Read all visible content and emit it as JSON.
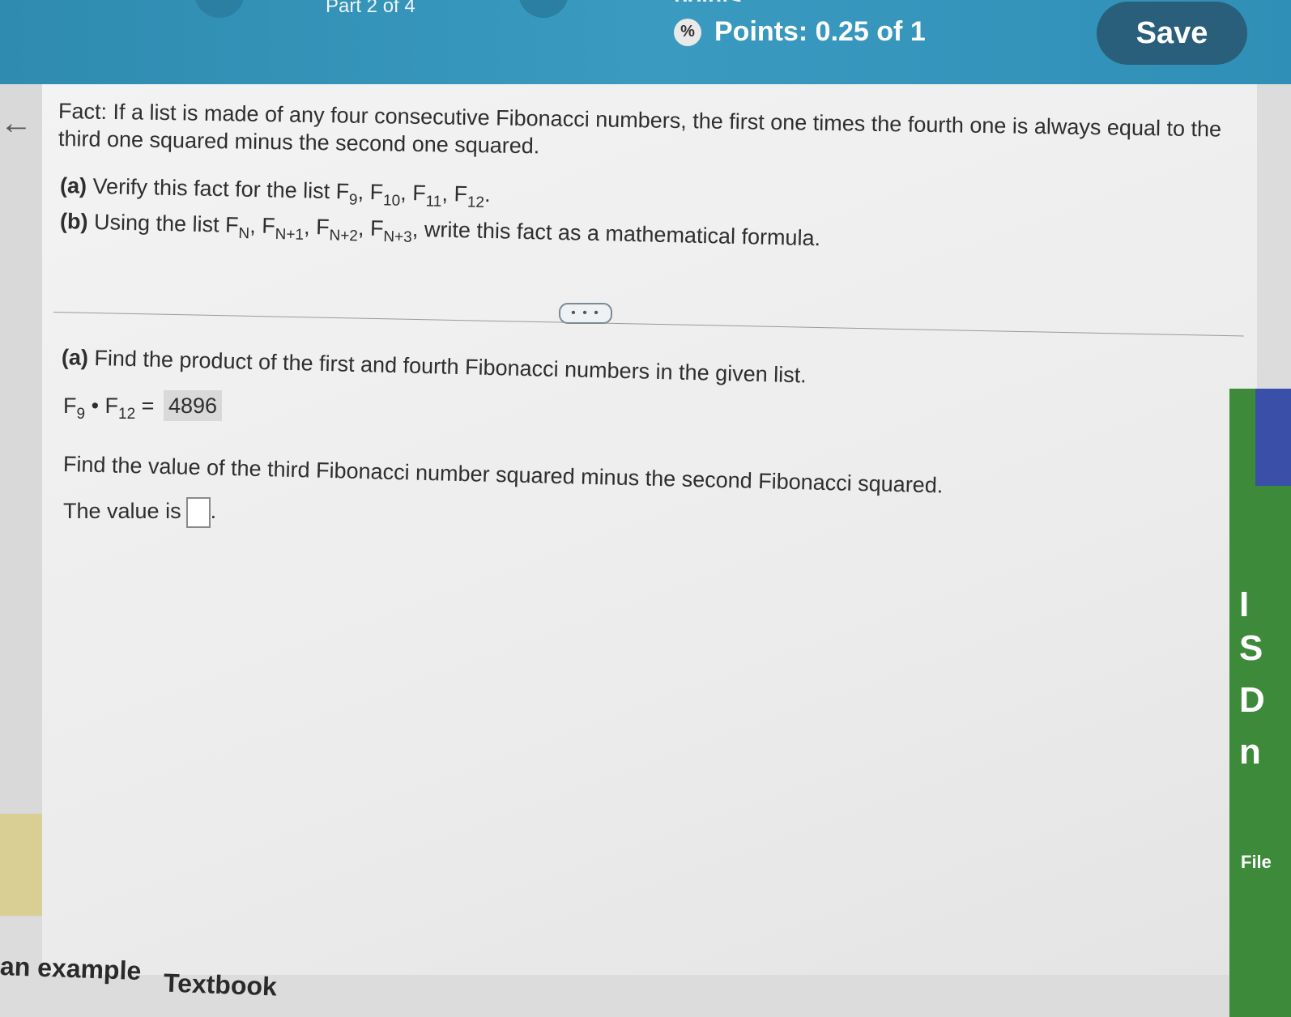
{
  "header": {
    "part_label": "Part 2 of 4",
    "points_top": "points",
    "points_text": "Points: 0.25 of 1",
    "points_icon": "%",
    "save_label": "Save"
  },
  "fact": {
    "line1": "Fact: If a list is made of any four consecutive Fibonacci numbers, the first one times the fourth one is always equal to the",
    "line2": "third one squared minus the second one squared."
  },
  "parts": {
    "a_label": "(a)",
    "a_text": " Verify this fact for the list F",
    "a_subs": [
      "9",
      "10",
      "11",
      "12"
    ],
    "b_label": "(b)",
    "b_text": " Using the list F",
    "b_subs": [
      "N",
      "N+1",
      "N+2",
      "N+3"
    ],
    "b_tail": " write this fact as a mathematical formula."
  },
  "expand": {
    "label": "• • •"
  },
  "solution": {
    "a_label": "(a)",
    "a_text": " Find the product of the first and fourth Fibonacci numbers in the given list.",
    "product_left": "F",
    "product_sub1": "9",
    "product_mid": " • F",
    "product_sub2": "12",
    "product_eq": " = ",
    "product_value": "4896",
    "find_text": "Find the value of the third Fibonacci number squared minus the second Fibonacci squared.",
    "value_prefix": "The value is"
  },
  "bottom": {
    "example_label": "an example",
    "textbook_label": "Textbook"
  },
  "side": {
    "letters": [
      "I",
      "S",
      "D",
      "n"
    ],
    "file_label": "File"
  }
}
